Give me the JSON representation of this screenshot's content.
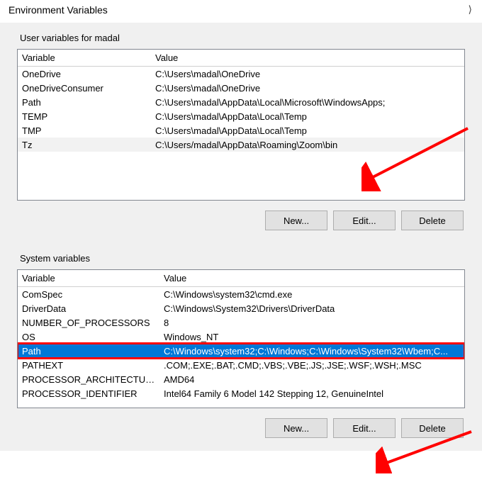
{
  "window": {
    "title": "Environment Variables"
  },
  "user_section": {
    "title": "User variables for madal",
    "headers": {
      "variable": "Variable",
      "value": "Value"
    },
    "rows": [
      {
        "variable": "OneDrive",
        "value": "C:\\Users\\madal\\OneDrive"
      },
      {
        "variable": "OneDriveConsumer",
        "value": "C:\\Users\\madal\\OneDrive"
      },
      {
        "variable": "Path",
        "value": "C:\\Users\\madal\\AppData\\Local\\Microsoft\\WindowsApps;"
      },
      {
        "variable": "TEMP",
        "value": "C:\\Users\\madal\\AppData\\Local\\Temp"
      },
      {
        "variable": "TMP",
        "value": "C:\\Users\\madal\\AppData\\Local\\Temp"
      },
      {
        "variable": "Tz",
        "value": "C:\\Users/madal\\AppData\\Roaming\\Zoom\\bin"
      }
    ],
    "buttons": {
      "new": "New...",
      "edit": "Edit...",
      "delete": "Delete"
    }
  },
  "system_section": {
    "title": "System variables",
    "headers": {
      "variable": "Variable",
      "value": "Value"
    },
    "rows": [
      {
        "variable": "ComSpec",
        "value": "C:\\Windows\\system32\\cmd.exe"
      },
      {
        "variable": "DriverData",
        "value": "C:\\Windows\\System32\\Drivers\\DriverData"
      },
      {
        "variable": "NUMBER_OF_PROCESSORS",
        "value": "8"
      },
      {
        "variable": "OS",
        "value": "Windows_NT"
      },
      {
        "variable": "Path",
        "value": "C:\\Windows\\system32;C:\\Windows;C:\\Windows\\System32\\Wbem;C..."
      },
      {
        "variable": "PATHEXT",
        "value": ".COM;.EXE;.BAT;.CMD;.VBS;.VBE;.JS;.JSE;.WSF;.WSH;.MSC"
      },
      {
        "variable": "PROCESSOR_ARCHITECTURE",
        "value": "AMD64"
      },
      {
        "variable": "PROCESSOR_IDENTIFIER",
        "value": "Intel64 Family 6 Model 142 Stepping 12, GenuineIntel"
      }
    ],
    "selected_index": 4,
    "buttons": {
      "new": "New...",
      "edit": "Edit...",
      "delete": "Delete"
    }
  }
}
